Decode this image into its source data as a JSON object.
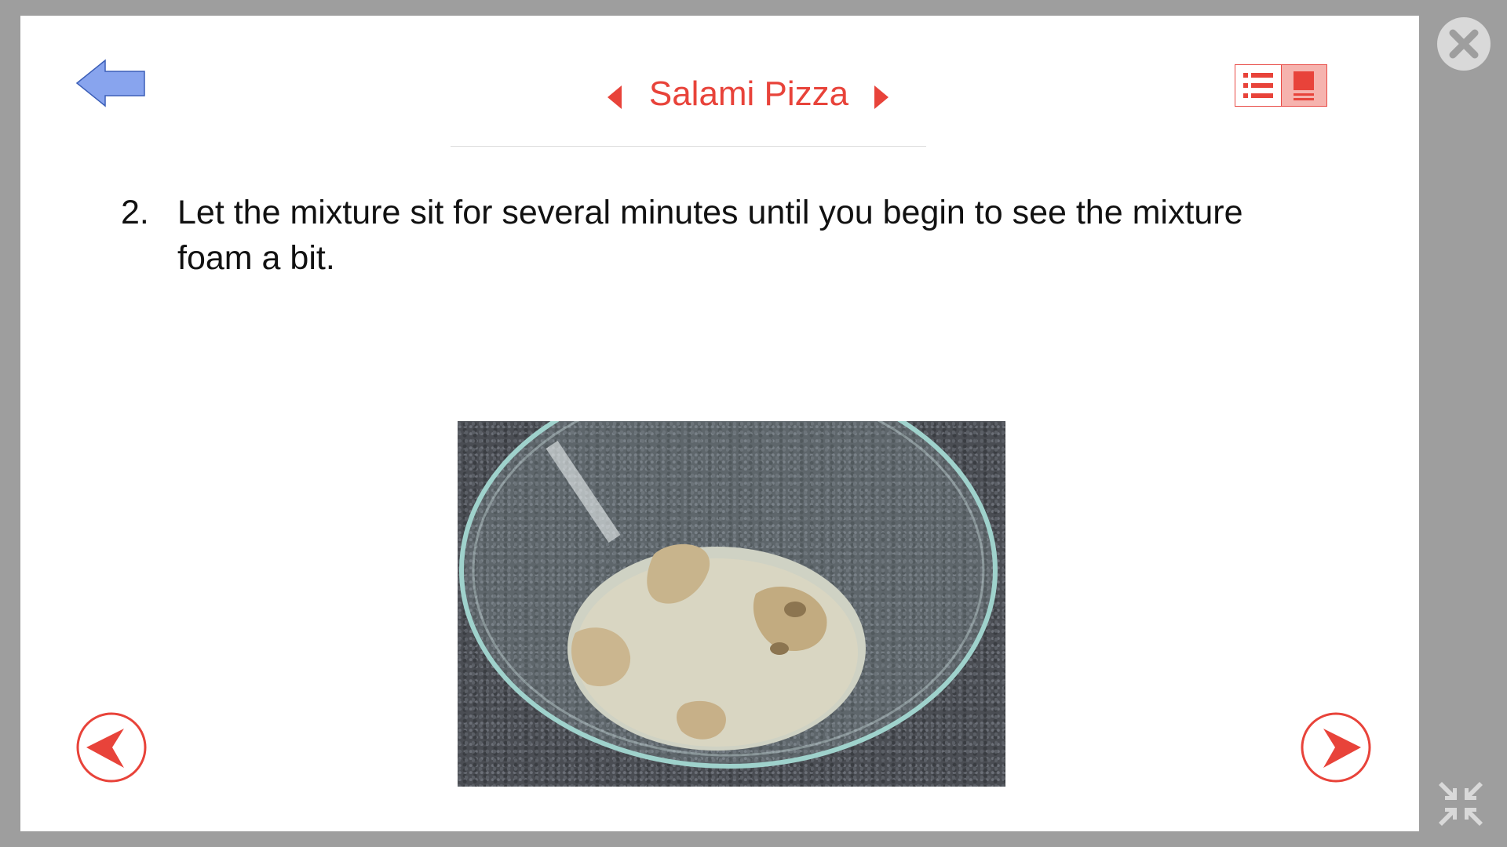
{
  "header": {
    "title": "Salami Pizza"
  },
  "step": {
    "number": "2.",
    "text": "Let the mixture sit for several minutes until you begin to see the mixture foam a bit."
  },
  "icons": {
    "back": "back-arrow-icon",
    "title_prev": "triangle-left-icon",
    "title_next": "triangle-right-icon",
    "view_list": "list-view-icon",
    "view_card": "card-view-icon",
    "nav_prev": "circle-arrow-left-icon",
    "nav_next": "circle-arrow-right-icon",
    "close": "close-icon",
    "collapse": "collapse-icon"
  },
  "colors": {
    "accent": "#e8433a",
    "back_arrow": "#88a4ee",
    "frame": "#9e9e9e"
  }
}
